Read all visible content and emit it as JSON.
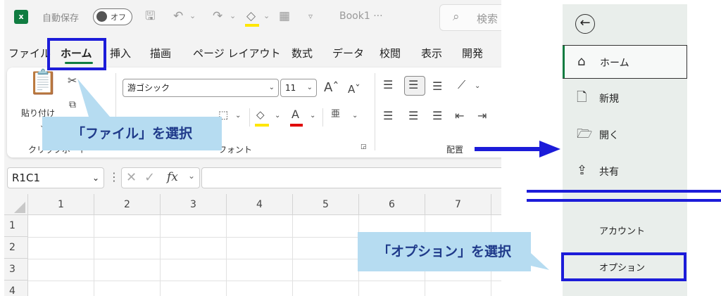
{
  "excel": {
    "logo": "x",
    "autosave_label": "自動保存",
    "autosave_state": "オフ",
    "book_name": "Book1",
    "book_suffix": "···",
    "search_placeholder": "検索",
    "tabs": [
      "ファイル",
      "ホーム",
      "挿入",
      "描画",
      "ページ レイアウト",
      "数式",
      "データ",
      "校閲",
      "表示",
      "開発"
    ],
    "active_tab": "ホーム",
    "ribbon": {
      "paste_label": "貼り付け",
      "clipboard_label": "クリップボード",
      "font_name": "游ゴシック",
      "font_size": "11",
      "font_group_label": "フォント",
      "alignment_label": "配置"
    },
    "name_box": "R1C1",
    "fx_label": "fx",
    "column_headers": [
      "1",
      "2",
      "3",
      "4",
      "5",
      "6",
      "7"
    ],
    "row_headers": [
      "1",
      "2",
      "3",
      "4"
    ]
  },
  "backstage": {
    "items": [
      {
        "icon": "home-icon",
        "label": "ホーム"
      },
      {
        "icon": "new-document-icon",
        "label": "新規"
      },
      {
        "icon": "folder-open-icon",
        "label": "開く"
      },
      {
        "icon": "share-icon",
        "label": "共有"
      }
    ],
    "account_label": "アカウント",
    "options_label": "オプション"
  },
  "annotations": {
    "select_file": "「ファイル」を選択",
    "select_options": "「オプション」を選択",
    "color": "#1c1cd9",
    "callout_bg": "#b6dcf1"
  }
}
